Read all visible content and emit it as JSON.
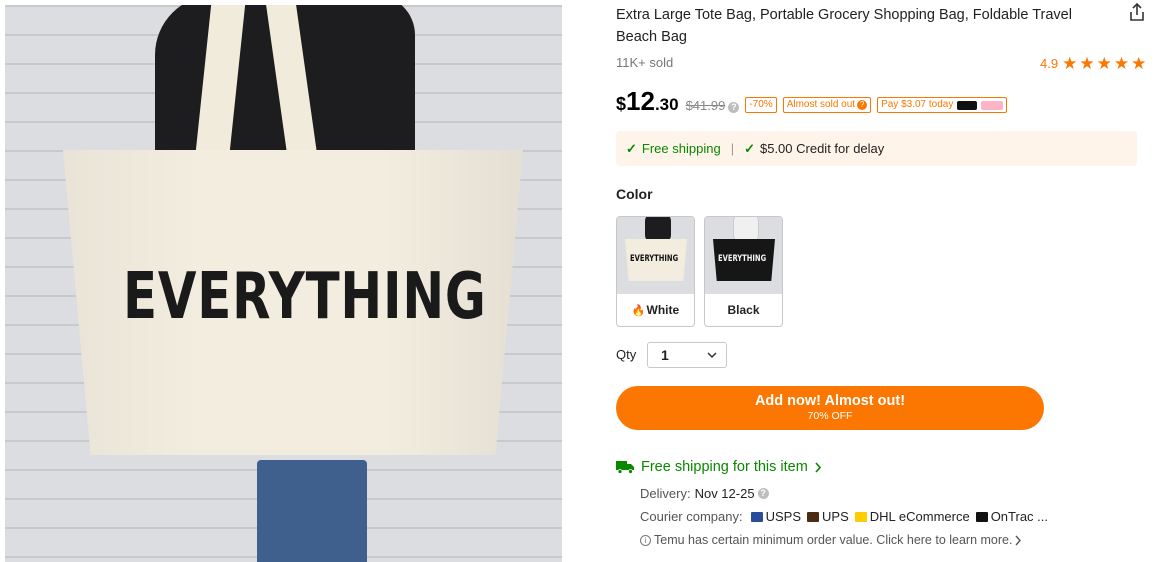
{
  "product": {
    "title": "Extra Large Tote Bag, Portable Grocery Shopping Bag, Foldable Travel Beach Bag",
    "image_text": "EVERYTHING",
    "sold": "11K+ sold",
    "rating": "4.9",
    "stars_shown": 5
  },
  "price": {
    "currency": "$",
    "integer": "12",
    "cents": ".30",
    "original": "$41.99",
    "discount_badge": "-70%",
    "almost_sold_badge": "Almost sold out",
    "pay_badge": "Pay $3.07 today"
  },
  "shipping_banner": {
    "free_shipping": "Free shipping",
    "separator": "|",
    "credit": "$5.00 Credit for delay"
  },
  "color": {
    "label": "Color",
    "options": [
      {
        "name": "White",
        "bag_text": "EVERYTHING",
        "selected": true
      },
      {
        "name": "Black",
        "bag_text": "EVERYTHING",
        "selected": false
      }
    ]
  },
  "quantity": {
    "label": "Qty",
    "value": "1"
  },
  "cta": {
    "main": "Add now! Almost out!",
    "sub": "70% OFF"
  },
  "delivery_info": {
    "free_item_link": "Free shipping for this item",
    "delivery_label": "Delivery:",
    "delivery_value": "Nov 12-25",
    "courier_label": "Courier company:",
    "couriers": [
      "USPS",
      "UPS",
      "DHL eCommerce",
      "OnTrac ..."
    ],
    "min_order_note": "Temu has certain minimum order value. Click here to learn more."
  },
  "colors": {
    "accent": "#fb7701",
    "green": "#0a8800",
    "banner_bg": "#fff4ea"
  },
  "icons": {
    "share": "share-icon",
    "star": "star-icon",
    "check": "check-icon",
    "truck": "truck-icon",
    "chevron_right": "chevron-right-icon",
    "chevron_down": "chevron-down-icon",
    "info": "info-icon",
    "flame": "flame-icon"
  }
}
